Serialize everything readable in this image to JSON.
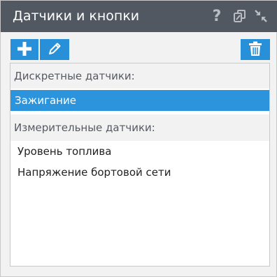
{
  "window": {
    "title": "Датчики и кнопки",
    "icons": [
      "help-icon",
      "copy-windows-icon",
      "collapse-icon"
    ],
    "help_glyph": "?"
  },
  "toolbar": {
    "buttons": [
      "add-icon",
      "edit-pencil-icon",
      "trash-icon"
    ]
  },
  "sensors": {
    "groups": [
      {
        "label": "Дискретные датчики:",
        "items": [
          {
            "label": "Зажигание",
            "selected": true
          }
        ]
      },
      {
        "label": "Измерительные датчики:",
        "items": [
          {
            "label": "Уровень топлива"
          },
          {
            "label": "Напряжение бортовой сети"
          }
        ]
      }
    ]
  },
  "colors": {
    "titlebar": "#525862",
    "accent": "#2790d9",
    "selected_row": "#2c94dc",
    "group_header_bg": "#f2f2f3",
    "panel_bg": "#f2f2f2"
  }
}
